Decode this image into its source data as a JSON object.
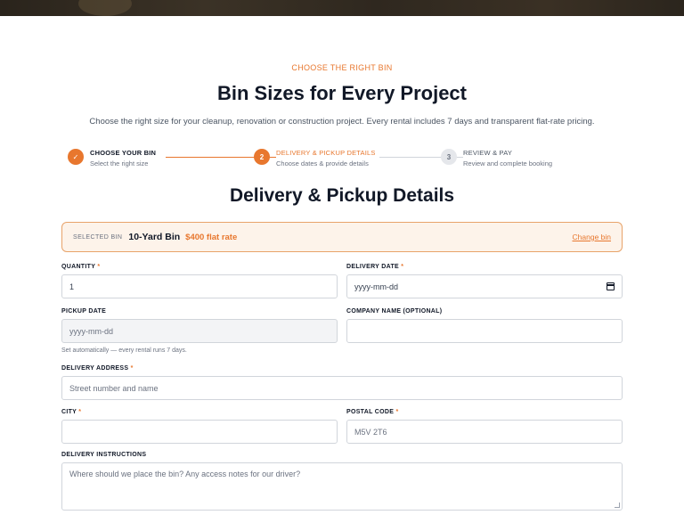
{
  "header": {
    "eyebrow": "CHOOSE THE RIGHT BIN",
    "title": "Bin Sizes for Every Project",
    "subtitle": "Choose the right size for your cleanup, renovation or construction project. Every rental includes 7 days and transparent flat-rate pricing."
  },
  "stepper": {
    "steps": [
      {
        "number": "✓",
        "title": "CHOOSE YOUR BIN",
        "sub": "Select the right size",
        "state": "done"
      },
      {
        "number": "2",
        "title": "DELIVERY & PICKUP DETAILS",
        "sub": "Choose dates & provide details",
        "state": "active"
      },
      {
        "number": "3",
        "title": "REVIEW & PAY",
        "sub": "Review and complete booking",
        "state": "todo"
      }
    ]
  },
  "section": {
    "title": "Delivery & Pickup Details"
  },
  "selected_bin": {
    "label": "SELECTED BIN",
    "name": "10-Yard Bin",
    "price": "$400 flat rate",
    "change_link": "Change bin"
  },
  "form": {
    "quantity": {
      "label": "QUANTITY",
      "required": "*",
      "value": "1"
    },
    "delivery_date": {
      "label": "DELIVERY DATE",
      "required": "*",
      "placeholder": "yyyy-mm-dd"
    },
    "pickup_date": {
      "label": "PICKUP DATE",
      "placeholder": "yyyy-mm-dd",
      "helper": "Set automatically — every rental runs 7 days."
    },
    "company_name": {
      "label": "COMPANY NAME (OPTIONAL)",
      "value": ""
    },
    "delivery_address": {
      "label": "DELIVERY ADDRESS",
      "required": "*",
      "placeholder": "Street number and name"
    },
    "city": {
      "label": "CITY",
      "required": "*",
      "value": ""
    },
    "postal_code": {
      "label": "POSTAL CODE",
      "required": "*",
      "placeholder": "M5V 2T6"
    },
    "delivery_instructions": {
      "label": "DELIVERY INSTRUCTIONS",
      "placeholder": "Where should we place the bin? Any access notes for our driver?"
    }
  },
  "colors": {
    "accent": "#e8772e",
    "selected_bg": "#fdf3ea"
  }
}
